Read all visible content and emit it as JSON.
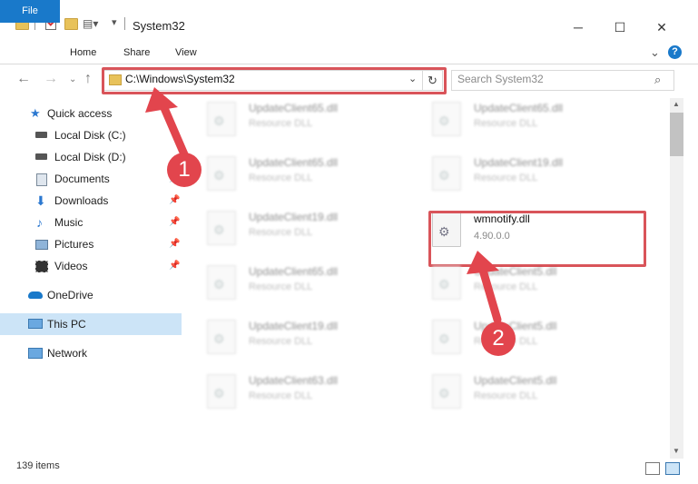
{
  "window": {
    "title": "System32",
    "minimize": "─",
    "maximize": "☐",
    "close": "✕"
  },
  "ribbon": {
    "tabs": [
      "File",
      "Home",
      "Share",
      "View"
    ],
    "help": "?"
  },
  "nav": {
    "address_path": "C:\\Windows\\System32",
    "search_placeholder": "Search System32"
  },
  "sidebar": {
    "items": [
      {
        "label": "Quick access",
        "icon": "star-icon",
        "pinned": false
      },
      {
        "label": "Local Disk (C:)",
        "icon": "drive-icon",
        "pinned": false
      },
      {
        "label": "Local Disk (D:)",
        "icon": "drive-icon",
        "pinned": false
      },
      {
        "label": "Documents",
        "icon": "documents-icon",
        "pinned": true
      },
      {
        "label": "Downloads",
        "icon": "download-icon",
        "pinned": true
      },
      {
        "label": "Music",
        "icon": "music-icon",
        "pinned": true
      },
      {
        "label": "Pictures",
        "icon": "pictures-icon",
        "pinned": true
      },
      {
        "label": "Videos",
        "icon": "videos-icon",
        "pinned": true
      },
      {
        "label": "OneDrive",
        "icon": "cloud-icon",
        "pinned": false
      },
      {
        "label": "This PC",
        "icon": "computer-icon",
        "pinned": false
      },
      {
        "label": "Network",
        "icon": "network-icon",
        "pinned": false
      }
    ]
  },
  "files": {
    "left_column": [
      {
        "name": "UpdateClient65.dll",
        "type": "Resource DLL"
      },
      {
        "name": "UpdateClient65.dll",
        "type": "Resource DLL"
      },
      {
        "name": "UpdateClient19.dll",
        "type": "Resource DLL"
      },
      {
        "name": "UpdateClient65.dll",
        "type": "Resource DLL"
      },
      {
        "name": "UpdateClient19.dll",
        "type": "Resource DLL"
      },
      {
        "name": "UpdateClient63.dll",
        "type": "Resource DLL"
      }
    ],
    "right_column": [
      {
        "name": "UpdateClient65.dll",
        "type": "Resource DLL"
      },
      {
        "name": "UpdateClient19.dll",
        "type": "Resource DLL"
      },
      {
        "name": "wmnotify.dll",
        "type": "4.90.0.0"
      },
      {
        "name": "UpdateClient5.dll",
        "type": "Resource DLL"
      },
      {
        "name": "UpdateClient5.dll",
        "type": "Resource DLL"
      },
      {
        "name": "UpdateClient5.dll",
        "type": "Resource DLL"
      }
    ]
  },
  "status": {
    "item_count": "139 items"
  },
  "callouts": {
    "step1": "1",
    "step2": "2"
  },
  "colors": {
    "accent": "#1979ca",
    "highlight": "#d9545a",
    "selected": "#cce4f7"
  }
}
